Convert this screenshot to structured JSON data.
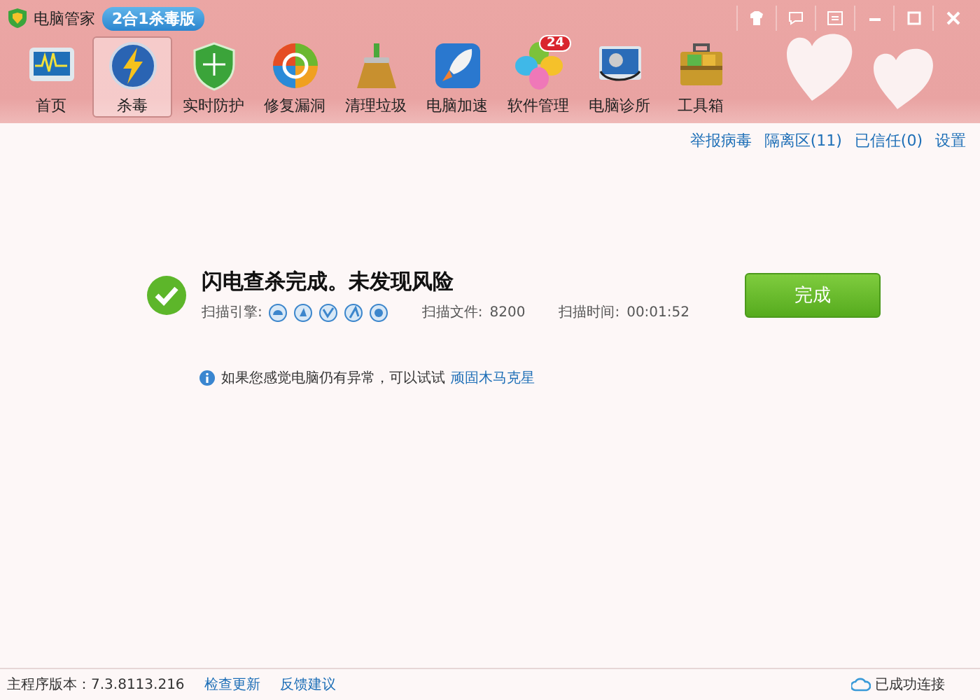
{
  "window": {
    "title": "电脑管家",
    "edition_badge": "2合1杀毒版"
  },
  "toolbar": [
    {
      "label": "首页",
      "selected": false,
      "kind": "monitor"
    },
    {
      "label": "杀毒",
      "selected": true,
      "kind": "bolt"
    },
    {
      "label": "实时防护",
      "selected": false,
      "kind": "shield"
    },
    {
      "label": "修复漏洞",
      "selected": false,
      "kind": "repair"
    },
    {
      "label": "清理垃圾",
      "selected": false,
      "kind": "broom"
    },
    {
      "label": "电脑加速",
      "selected": false,
      "kind": "rocket"
    },
    {
      "label": "软件管理",
      "selected": false,
      "kind": "clover",
      "badge": "24"
    },
    {
      "label": "电脑诊所",
      "selected": false,
      "kind": "clinic"
    },
    {
      "label": "工具箱",
      "selected": false,
      "kind": "toolbox"
    }
  ],
  "links": [
    "举报病毒",
    "隔离区(11)",
    "已信任(0)",
    "设置"
  ],
  "result": {
    "title": "闪电查杀完成。未发现风险",
    "engines_label": "扫描引擎:",
    "files_label": "扫描文件:",
    "files": "8200",
    "time_label": "扫描时间:",
    "time": "00:01:52",
    "button": "完成"
  },
  "hint": {
    "text": "如果您感觉电脑仍有异常，可以试试",
    "link": "顽固木马克星"
  },
  "status_bar": {
    "version_label": "主程序版本：",
    "version": "7.3.8113.216",
    "links": [
      "检查更新",
      "反馈建议"
    ],
    "connection": "已成功连接"
  }
}
